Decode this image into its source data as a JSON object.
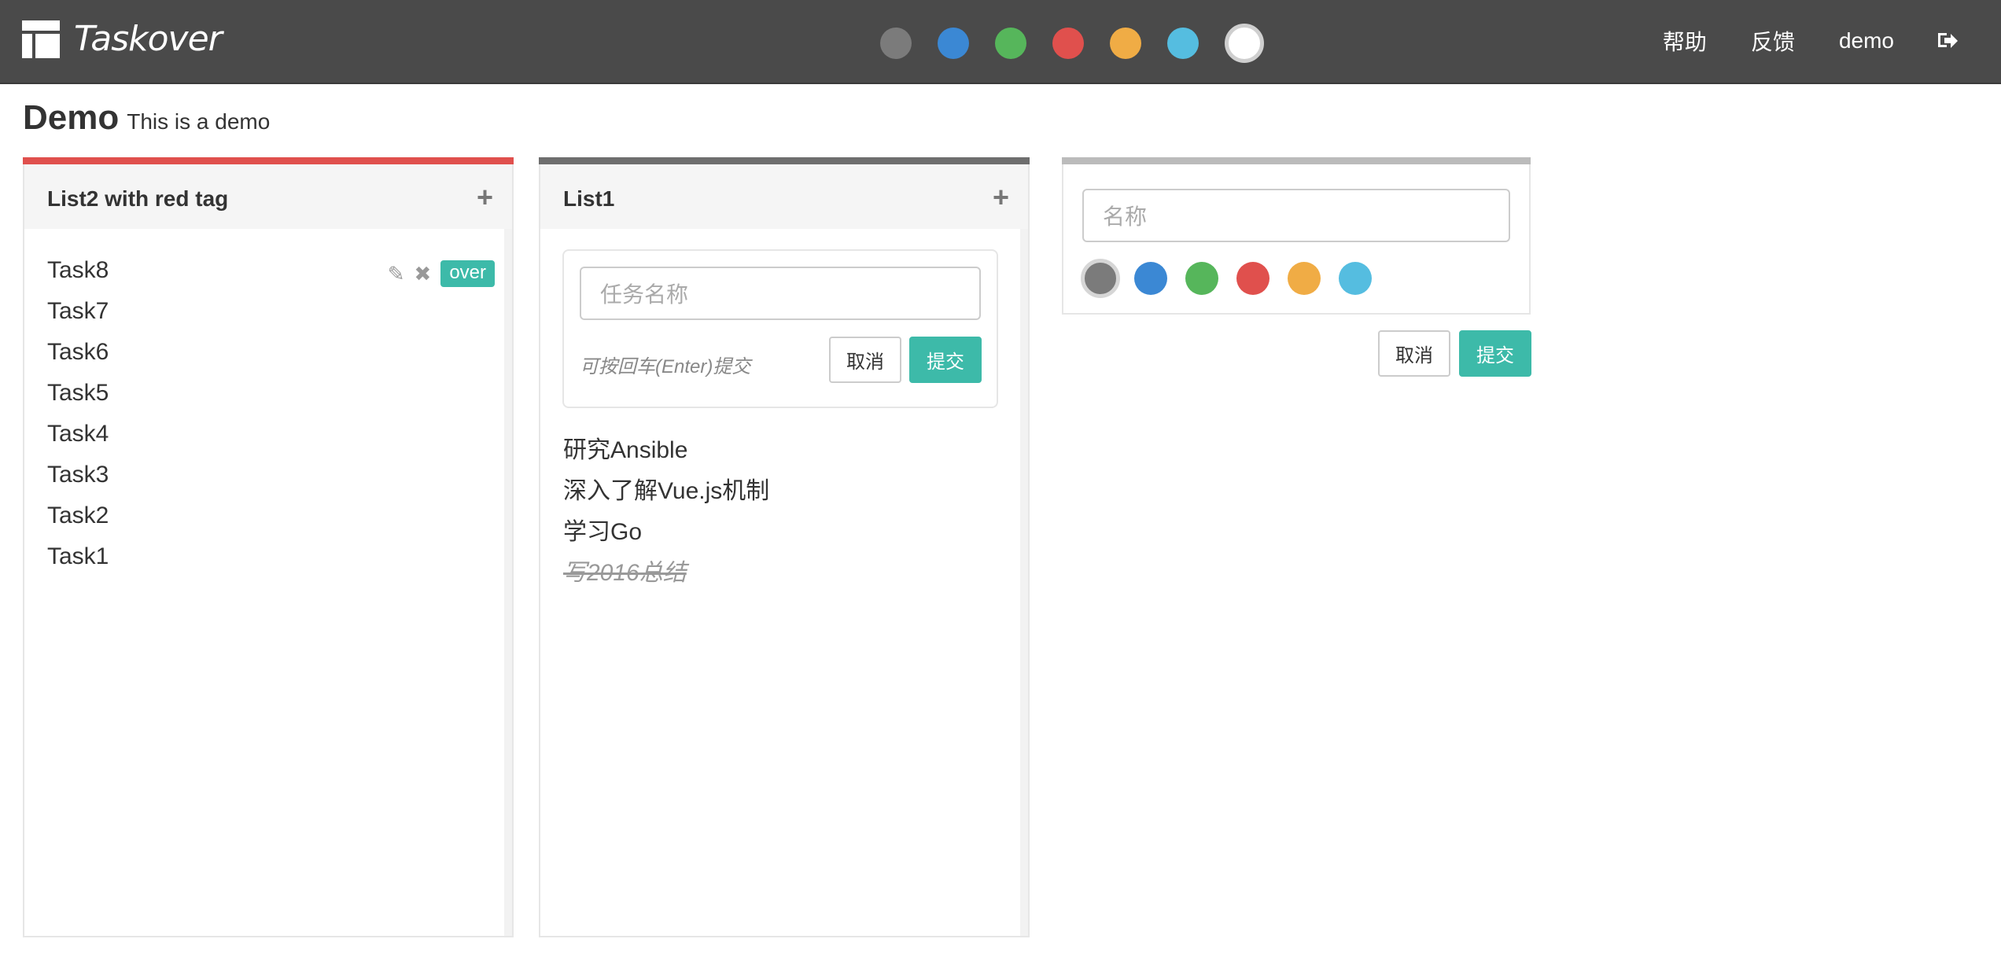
{
  "app": {
    "name": "Taskover"
  },
  "theme_colors": [
    {
      "name": "gray",
      "hex": "#7b7b7b"
    },
    {
      "name": "blue",
      "hex": "#3b88d4"
    },
    {
      "name": "green",
      "hex": "#56b65b"
    },
    {
      "name": "red",
      "hex": "#e0504d"
    },
    {
      "name": "orange",
      "hex": "#f0ac45"
    },
    {
      "name": "cyan",
      "hex": "#55bde0"
    },
    {
      "name": "white",
      "hex": "#ffffff",
      "selected": true
    }
  ],
  "nav": {
    "help": "帮助",
    "feedback": "反馈",
    "user": "demo",
    "logout_icon": "sign-out-icon"
  },
  "board": {
    "title": "Demo",
    "description": "This is a demo"
  },
  "lists": [
    {
      "title": "List2 with red tag",
      "tag_color": "#e0504d",
      "tasks": [
        "Task8",
        "Task7",
        "Task6",
        "Task5",
        "Task4",
        "Task3",
        "Task2",
        "Task1"
      ],
      "hover_task": {
        "badge": "over",
        "edit_icon": "pencil-icon",
        "delete_icon": "close-icon"
      }
    },
    {
      "title": "List1",
      "tag_color": "#6e6e6e",
      "new_task": {
        "placeholder": "任务名称",
        "hint": "可按回车(Enter)提交",
        "cancel": "取消",
        "submit": "提交"
      },
      "tasks": [
        {
          "text": "研究Ansible",
          "done": false
        },
        {
          "text": "深入了解Vue.js机制",
          "done": false
        },
        {
          "text": "学习Go",
          "done": false
        },
        {
          "text": "写2016总结",
          "done": true
        }
      ]
    }
  ],
  "new_list": {
    "placeholder": "名称",
    "colors": [
      "#7b7b7b",
      "#3b88d4",
      "#56b65b",
      "#e0504d",
      "#f0ac45",
      "#55bde0"
    ],
    "selected_color": "#7b7b7b",
    "cancel": "取消",
    "submit": "提交"
  },
  "accent": "#3dbaa9"
}
